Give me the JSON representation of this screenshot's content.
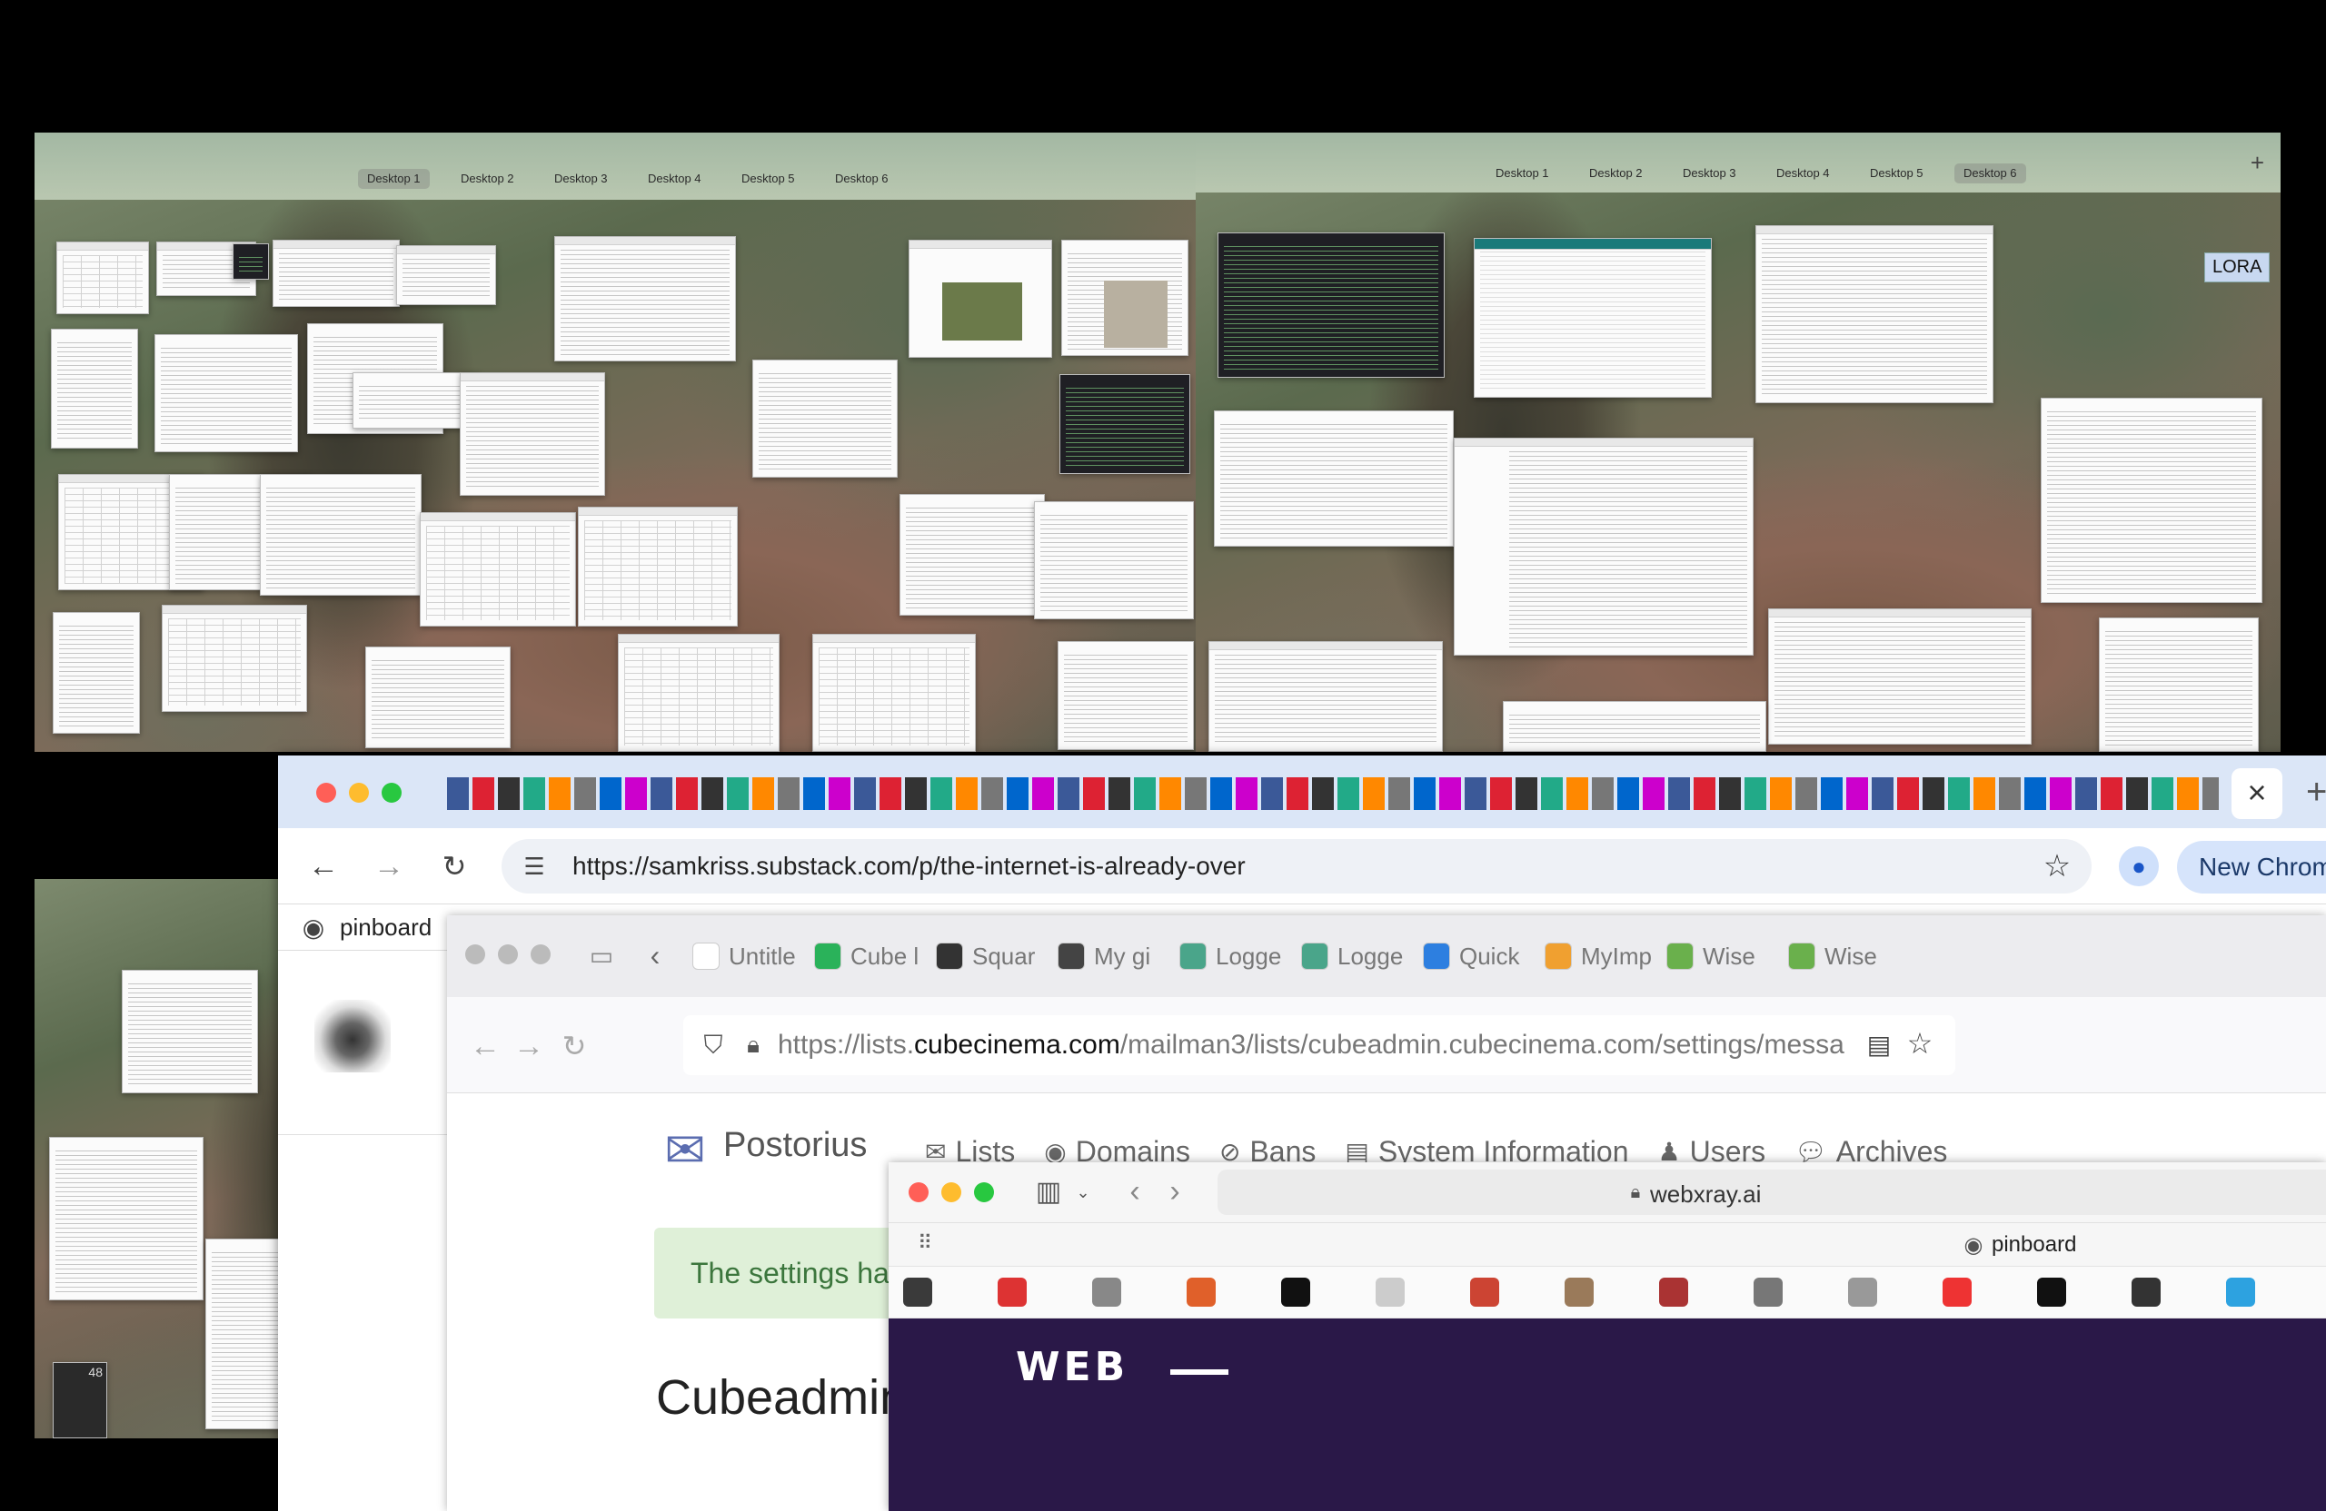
{
  "mission_control_left": {
    "desktops": [
      "Desktop 1",
      "Desktop 2",
      "Desktop 3",
      "Desktop 4",
      "Desktop 5",
      "Desktop 6"
    ],
    "active_index": 0
  },
  "mission_control_right": {
    "desktops": [
      "Desktop 1",
      "Desktop 2",
      "Desktop 3",
      "Desktop 4",
      "Desktop 5",
      "Desktop 6"
    ],
    "active_index": 5,
    "add_button": "+",
    "label_badge": "LORA"
  },
  "calculator_widget": {
    "display": "48"
  },
  "chrome": {
    "close_tab": "×",
    "new_tab": "+",
    "url": "https://samkriss.substack.com/p/the-internet-is-already-over",
    "profile_button": "New Chrom",
    "bookmark_pinboard": "pinboard"
  },
  "firefox": {
    "tabs": [
      "Untitle",
      "Cube l",
      "Squar",
      "My gi",
      "Logge",
      "Logge",
      "Quick",
      "MyImp",
      "Wise",
      "Wise"
    ],
    "tab_icon_colors": [
      "#ffffff",
      "#2ab25a",
      "#333333",
      "#444444",
      "#4aa58a",
      "#4aa58a",
      "#2d7fe0",
      "#f0a030",
      "#6ab04c",
      "#6ab04c"
    ],
    "url_prefix": "https://lists.",
    "url_domain": "cubecinema.com",
    "url_suffix": "/mailman3/lists/cubeadmin.cubecinema.com/settings/messa"
  },
  "postorius": {
    "brand": "Postorius",
    "nav": [
      "Lists",
      "Domains",
      "Bans",
      "System Information",
      "Users",
      "Archives"
    ],
    "notice": "The settings ha",
    "heading": "Cubeadmin"
  },
  "safari": {
    "url": "webxray.ai",
    "bookmark": "pinboard",
    "logo_text": "WEB",
    "bookmarks_bar": [
      "#3a3a3a",
      "#d33",
      "#888",
      "#e0602a",
      "#111",
      "#ccc",
      "#c43",
      "#9a7a5a",
      "#a33",
      "#777",
      "#999",
      "#e33",
      "#111",
      "#333",
      "#2da2e0"
    ]
  },
  "colors": {
    "accent_blue": "#1a73e8",
    "traffic_red": "#ff5f57",
    "traffic_yellow": "#febc2e",
    "traffic_green": "#28c840",
    "webxray_purple": "#2a1848"
  }
}
